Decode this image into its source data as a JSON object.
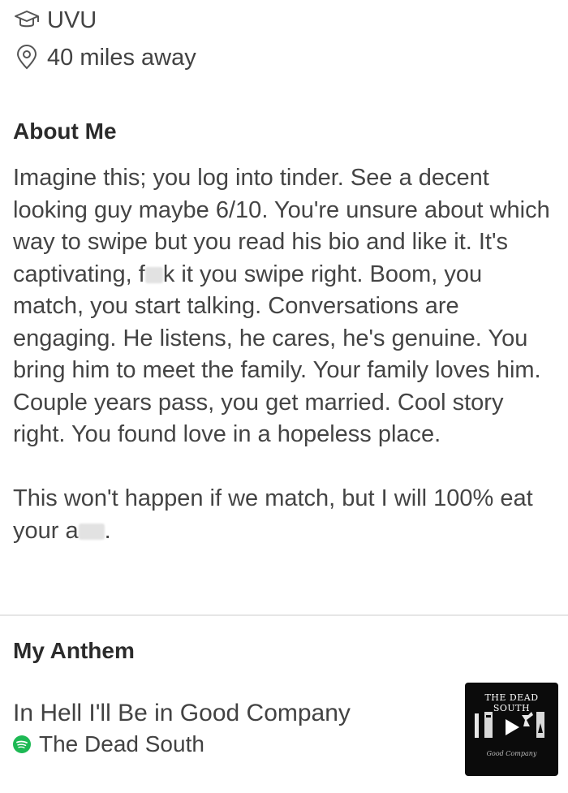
{
  "profile": {
    "school": "UVU",
    "distance": "40 miles away"
  },
  "about": {
    "heading": "About Me",
    "p1_a": "Imagine this; you log into tinder. See a decent looking guy maybe 6/10. You're unsure about which way to swipe but you read his bio and like it. It's captivating, f",
    "p1_b": "k it you swipe right. Boom, you match, you start talking. Conversations are engaging. He listens, he cares, he's genuine. You bring him to meet the family. Your family loves him. Couple years pass, you get married. Cool story right. You found love in a hopeless place.",
    "p2_a": "This won't happen if we match, but I will 100% eat your a",
    "p2_b": "."
  },
  "anthem": {
    "heading": "My Anthem",
    "song": "In Hell I'll Be in Good Company",
    "artist": "The Dead South",
    "album_title": "THE DEAD SOUTH",
    "album_subtitle": "Good Company"
  },
  "icons": {
    "school": "graduation-cap-icon",
    "location": "location-pin-icon",
    "spotify": "spotify-icon",
    "play": "play-icon"
  },
  "colors": {
    "spotify_green": "#1db954",
    "text": "#424242"
  }
}
